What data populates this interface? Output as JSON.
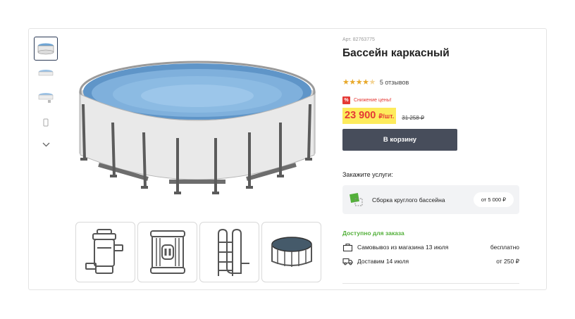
{
  "product": {
    "article": "Арт. 82763775",
    "title": "Бассейн каркасный",
    "reviews": "5 отзывов",
    "rating": 4.5,
    "promo_badge": "%",
    "promo_text": "Снижение цены!",
    "price": "23 900",
    "price_unit": "₽/шт.",
    "old_price": "31 258 ₽",
    "cart_button": "В корзину"
  },
  "services": {
    "label": "Закажите услуги:",
    "items": [
      {
        "name": "Сборка круглого бассейна",
        "price": "от 5 000 ₽"
      }
    ]
  },
  "delivery": {
    "availability": "Доступно для заказа",
    "rows": [
      {
        "icon": "shopping-bag-icon",
        "text": "Самовывоз из магазина 13 июля",
        "value": "бесплатно"
      },
      {
        "icon": "truck-icon",
        "text": "Доставим 14 июля",
        "value": "от 250 ₽"
      }
    ]
  },
  "gallery": {
    "thumbnails": [
      "pool-thumbnail",
      "pool-top-thumbnail",
      "pool-angle-thumbnail",
      "accessory-thumbnail"
    ],
    "accessories": [
      "filter-pump-icon",
      "filter-cartridge-icon",
      "pool-ladder-icon",
      "pool-cover-icon"
    ]
  },
  "colors": {
    "accent_red": "#e53935",
    "price_highlight": "#fdeb5c",
    "button_dark": "#474d5b",
    "available_green": "#53b03a"
  }
}
